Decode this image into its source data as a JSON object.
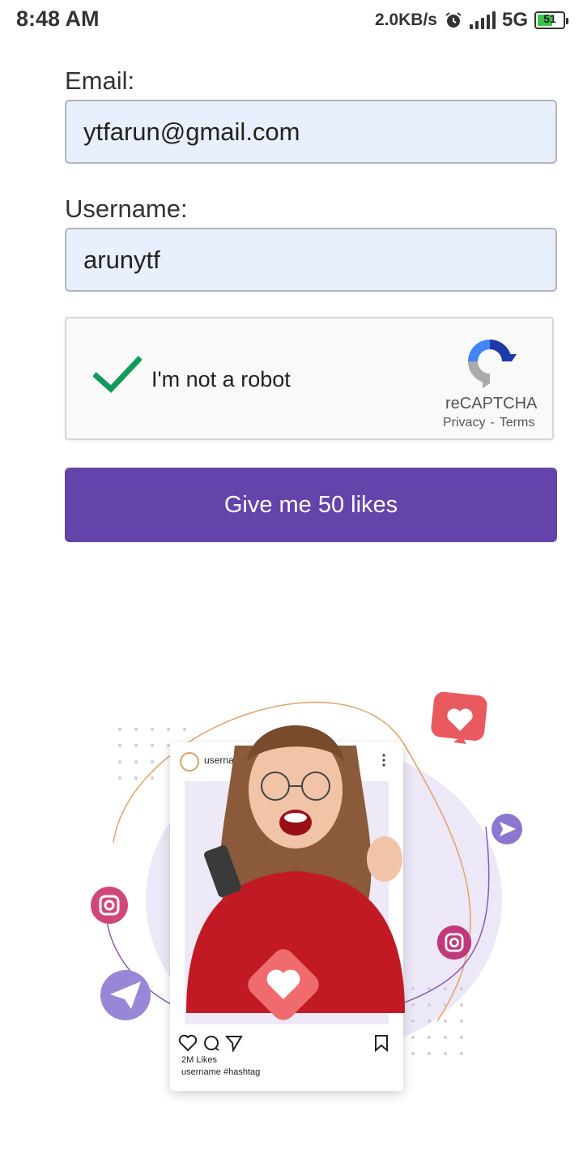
{
  "status_bar": {
    "time": "8:48 AM",
    "net_speed": "2.0KB/s",
    "network_type": "5G",
    "battery_level": "51"
  },
  "form": {
    "email_label": "Email:",
    "email_value": "ytfarun@gmail.com",
    "username_label": "Username:",
    "username_value": "arunytf",
    "submit_label": "Give me 50 likes",
    "button_color": "#6444aa",
    "field_bg": "#e8f0fe"
  },
  "recaptcha": {
    "label": "I'm not a robot",
    "checked": true,
    "brand": "reCAPTCHA",
    "privacy": "Privacy",
    "separator": "-",
    "terms": "Terms"
  },
  "post_card": {
    "username": "usernam",
    "likes": "2M Likes",
    "caption": "username #hashtag"
  }
}
